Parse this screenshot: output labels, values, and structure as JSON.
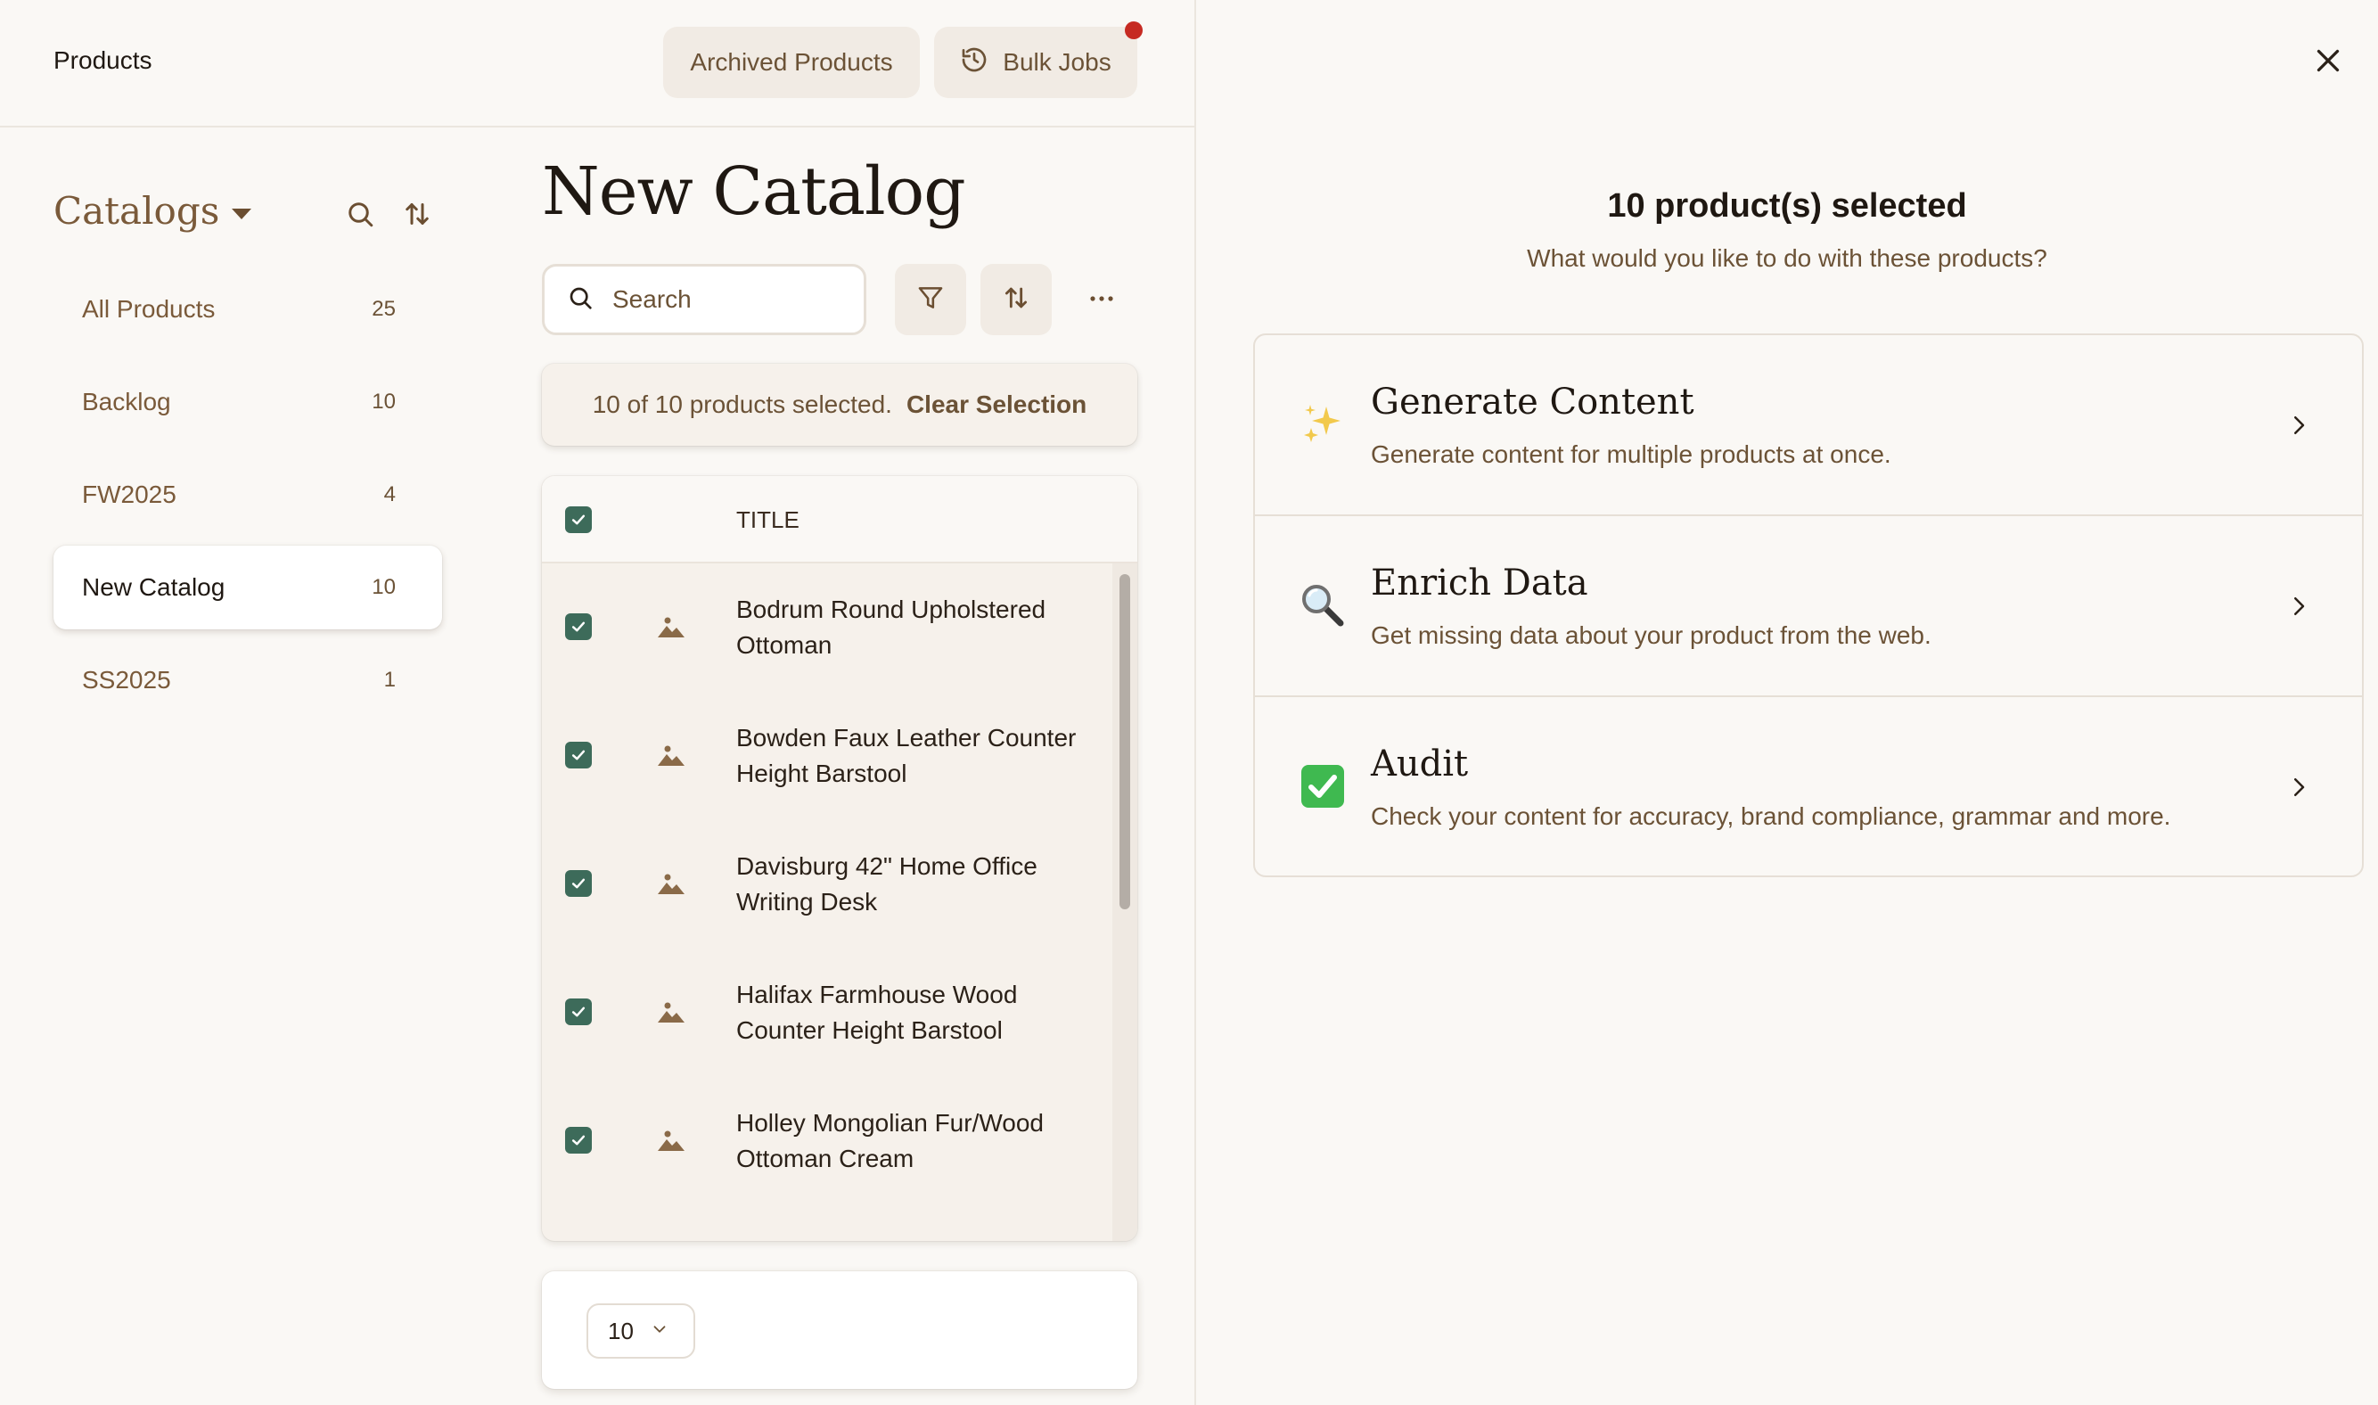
{
  "header": {
    "title": "Products",
    "archived_label": "Archived Products",
    "bulk_jobs_label": "Bulk Jobs",
    "notification_color": "#c62a22"
  },
  "sidebar": {
    "title": "Catalogs",
    "items": [
      {
        "label": "All Products",
        "count": "25",
        "active": false
      },
      {
        "label": "Backlog",
        "count": "10",
        "active": false
      },
      {
        "label": "FW2025",
        "count": "4",
        "active": false
      },
      {
        "label": "New Catalog",
        "count": "10",
        "active": true
      },
      {
        "label": "SS2025",
        "count": "1",
        "active": false
      }
    ]
  },
  "main": {
    "title": "New Catalog",
    "search_placeholder": "Search",
    "selection_text": "10 of 10 products selected.",
    "clear_label": "Clear Selection",
    "table": {
      "header_title": "TITLE",
      "rows": [
        {
          "title": "Bodrum Round Upholstered Ottoman",
          "checked": true
        },
        {
          "title": "Bowden Faux Leather Counter Height Barstool",
          "checked": true
        },
        {
          "title": "Davisburg 42\" Home Office Writing Desk",
          "checked": true
        },
        {
          "title": "Halifax Farmhouse Wood Counter Height Barstool",
          "checked": true
        },
        {
          "title": "Holley Mongolian Fur/Wood Ottoman Cream",
          "checked": true
        }
      ]
    },
    "page_size": "10"
  },
  "panel": {
    "heading": "10 product(s) selected",
    "subheading": "What would you like to do with these products?",
    "actions": [
      {
        "icon": "sparkles-icon",
        "title": "Generate Content",
        "description": "Generate content for multiple products at once."
      },
      {
        "icon": "magnifier-icon",
        "title": "Enrich Data",
        "description": "Get missing data about your product from the web."
      },
      {
        "icon": "check-mark-icon",
        "title": "Audit",
        "description": "Check your content for accuracy, brand compliance, grammar and more."
      }
    ]
  },
  "colors": {
    "accent_brown": "#6b5236",
    "checkbox_green": "#3d6b5a",
    "background": "#faf8f5"
  }
}
